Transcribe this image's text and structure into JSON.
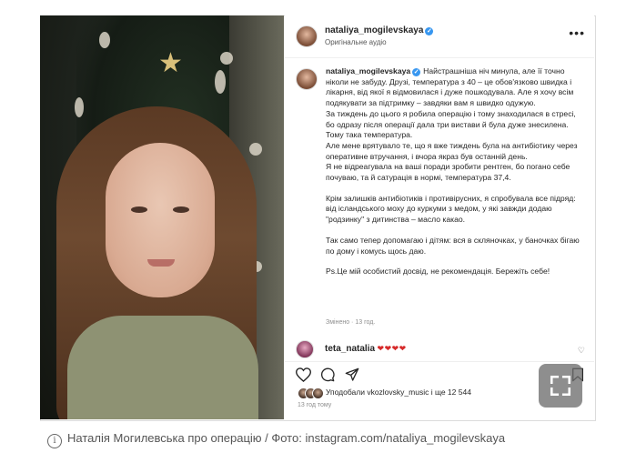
{
  "post": {
    "username": "nataliya_mogilevskaya",
    "audio": "Оригінальне аудіо",
    "more_label": "•••",
    "caption": {
      "text_1": "Найстрашніша ніч минула, але її точно ніколи не забуду. Друзі, температура з 40 – це обов'язково швидка і лікарня, від якої я відмовилася і дуже пошкодувала. Але я хочу всім подякувати за підтримку – завдяки вам я швидко одужую.",
      "text_2": "За тиждень до цього я робила операцію і тому знаходилася в стресі, бо одразу після операції дала три вистави й була дуже знесилена. Тому така температура.",
      "text_3": "Але мене врятувало те, що я вже тиждень була на антибіотику через оперативне втручання, і вчора якраз був останній день.",
      "text_4": "Я не відреагувала на ваші поради зробити рентген, бо погано себе почуваю, та й сатурація в нормі, температура 37,4.",
      "text_5": "Крім залишків антибіотиків і противірусних, я спробувала все підряд: від ісландського моху до куркуми з медом, у які завжди додаю \"родзинку\" з дитинства – масло какао.",
      "text_6": "Так само тепер допомагаю і дітям: вся в скляночках, у баночках бігаю по дому і комусь щось даю.",
      "text_7": "Ps.Це мій особистий досвід, не рекомендація. Бережіть себе!"
    },
    "edited": "Змінено · 13 год.",
    "comment": {
      "username": "teta_natalia",
      "hearts": "❤❤❤❤"
    },
    "likes_text": "Уподобали vkozlovsky_music і ще 12 544",
    "likes_user": "vkozlovsky_music",
    "time_ago": "13 год тому"
  },
  "icons": [
    "verified-icon",
    "heart-icon",
    "comment-icon",
    "share-icon",
    "bookmark-icon",
    "expand-icon",
    "info-icon"
  ],
  "photo_caption": "Наталія Могилевська про операцію / Фото: instagram.com/nataliya_mogilevskaya",
  "colors": {
    "verified": "#3897f0",
    "hearts": "#d62a2a",
    "overlay": "#6e6e6e"
  }
}
